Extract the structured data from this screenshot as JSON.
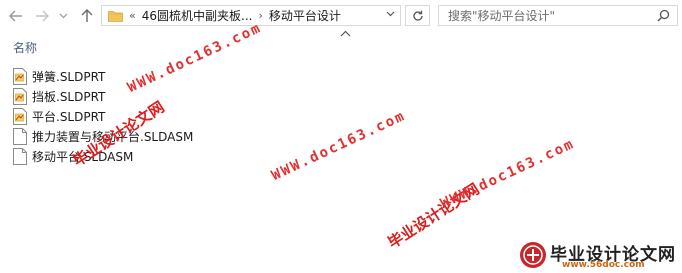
{
  "address": {
    "overflow": "«",
    "crumbs": [
      "46圆梳机中副夹板...",
      "移动平台设计"
    ]
  },
  "search": {
    "placeholder": "搜索\"移动平台设计\""
  },
  "columns": {
    "name": "名称"
  },
  "files": [
    {
      "name": "弹簧.SLDPRT",
      "icon": "sldprt-file-icon"
    },
    {
      "name": "挡板.SLDPRT",
      "icon": "sldprt-file-icon"
    },
    {
      "name": "平台.SLDPRT",
      "icon": "sldprt-file-icon"
    },
    {
      "name": "推力装置与移动平台.SLDASM",
      "icon": "blank-file-icon"
    },
    {
      "name": "移动平台.SLDASM",
      "icon": "blank-file-icon"
    }
  ],
  "watermarks": {
    "cn": "毕业设计论文网",
    "url": "WWW.doc163.com"
  },
  "logo": {
    "title": "毕业设计论文网",
    "url": "www.56doc.com"
  },
  "colors": {
    "watermark": "#dd1c1c",
    "header_text": "#4c607a",
    "folder": "#f2c55c"
  }
}
